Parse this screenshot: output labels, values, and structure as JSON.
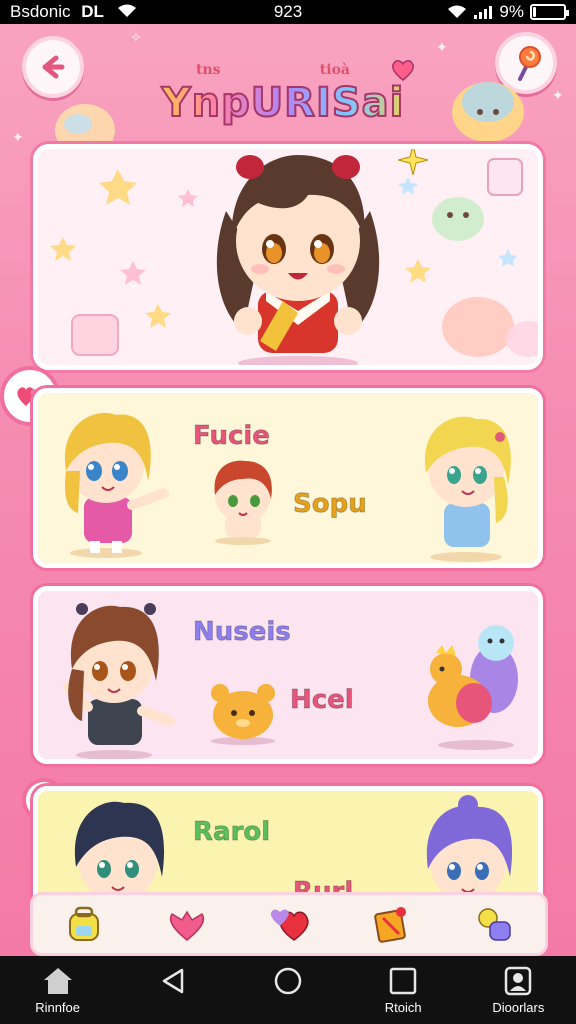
{
  "status_bar": {
    "carrier": "Bsdonic",
    "carrier_badge": "DL",
    "time": "923",
    "battery_percent": "9%",
    "battery_level": 0.09
  },
  "header": {
    "logo_title": "YnpURISai",
    "logo_subtext_left": "tns",
    "logo_subtext_right": "tioà",
    "back_icon": "arrow-back-icon",
    "right_icon": "lollipop-icon"
  },
  "cards": [
    {
      "labels": [
        "Fucie",
        "Sopu"
      ],
      "colors": [
        "#e8557a",
        "#e6a21a"
      ]
    },
    {
      "labels": [
        "Nuseis",
        "Hcel"
      ],
      "colors": [
        "#8e7ff0",
        "#e8557a"
      ]
    },
    {
      "labels": [
        "Rarol",
        "Rurl"
      ],
      "colors": [
        "#5cc05a",
        "#e8557a"
      ]
    }
  ],
  "tabs": [
    {
      "icon": "backpack-icon"
    },
    {
      "icon": "bow-icon"
    },
    {
      "icon": "hearts-icon"
    },
    {
      "icon": "gift-icon"
    },
    {
      "icon": "candy-icon"
    }
  ],
  "nav": [
    {
      "icon": "home-icon",
      "label": "Rinnfoe"
    },
    {
      "icon": "back-triangle-icon",
      "label": ""
    },
    {
      "icon": "home-circle-icon",
      "label": ""
    },
    {
      "icon": "recent-square-icon",
      "label": "Rtoich"
    },
    {
      "icon": "person-icon",
      "label": "Dioorlars"
    }
  ]
}
